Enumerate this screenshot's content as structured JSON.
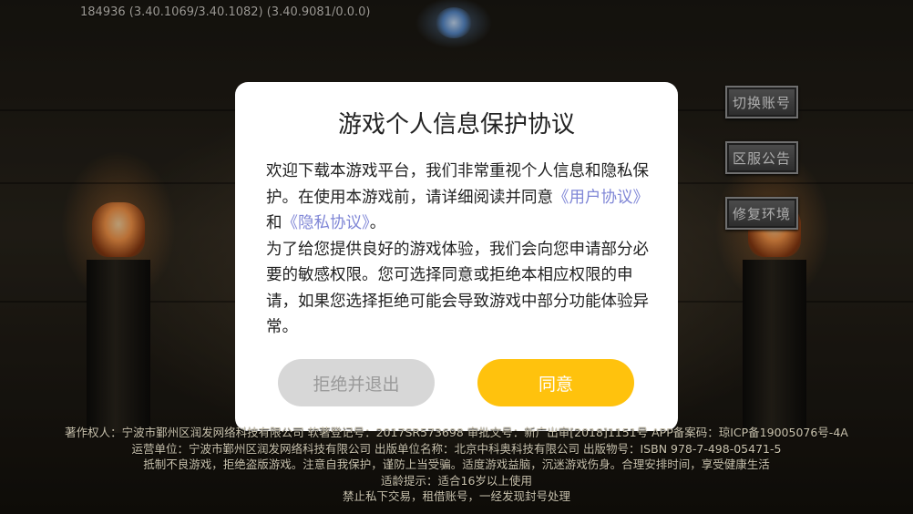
{
  "build_info": "184936 (3.40.1069/3.40.1082) (3.40.9081/0.0.0)",
  "side_buttons": {
    "switch_account": "切换账号",
    "server_notice": "区服公告",
    "repair_env": "修复环境"
  },
  "dialog": {
    "title": "游戏个人信息保护协议",
    "body_part1": "欢迎下载本游戏平台，我们非常重视个人信息和隐私保护。在使用本游戏前，请详细阅读并同意",
    "user_agreement_link": "《用户协议》",
    "and_text": "和",
    "privacy_link": "《隐私协议》",
    "period": "。",
    "body_part2": "为了给您提供良好的游戏体验，我们会向您申请部分必要的敏感权限。您可选择同意或拒绝本相应权限的申请，如果您选择拒绝可能会导致游戏中部分功能体验异常。",
    "reject_label": "拒绝并退出",
    "agree_label": "同意"
  },
  "footer": {
    "line1": "著作权人：宁波市鄞州区润发网络科技有限公司 软著登记号：2017SR573698 审批文号：新广出审[2018]1151号 APP备案码：琼ICP备19005076号-4A",
    "line2": "运营单位：宁波市鄞州区润发网络科技有限公司 出版单位名称：北京中科奥科技有限公司  出版物号：ISBN 978-7-498-05471-5",
    "line3": "抵制不良游戏，拒绝盗版游戏。注意自我保护，谨防上当受骗。适度游戏益脑，沉迷游戏伤身。合理安排时间，享受健康生活",
    "line4": "适龄提示：适合16岁以上使用",
    "line5": "禁止私下交易，租借账号，一经发现封号处理"
  },
  "colors": {
    "agree_button": "#ffc20d",
    "reject_button": "#d7d7d7",
    "link": "#7f86d6"
  }
}
